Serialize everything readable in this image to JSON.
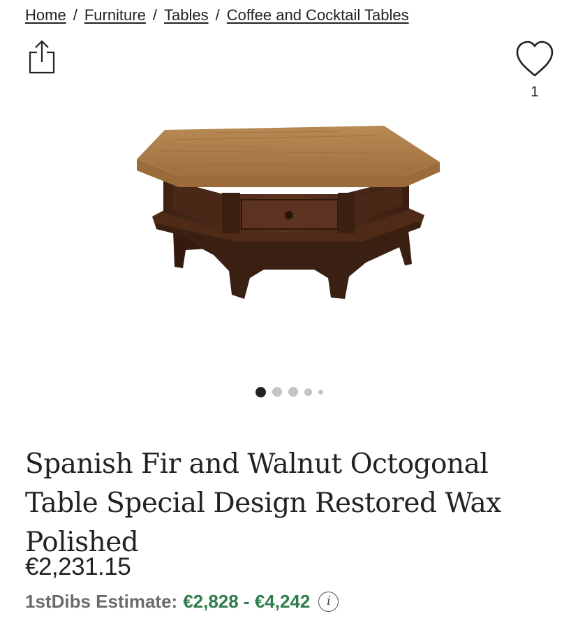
{
  "breadcrumb": {
    "items": [
      "Home",
      "Furniture",
      "Tables",
      "Coffee and Cocktail Tables"
    ],
    "separator": "/"
  },
  "actions": {
    "share_icon": "share-icon",
    "favorite_icon": "heart-icon",
    "favorite_count": "1"
  },
  "gallery": {
    "image_alt": "Spanish Fir and Walnut Octogonal Table",
    "slide_count": 5,
    "active_index": 0
  },
  "product": {
    "title": "Spanish Fir and Walnut Octogonal Table Special Design Restored Wax Polished",
    "price": "€2,231.15",
    "estimate_label": "1stDibs Estimate:",
    "estimate_value": "€2,828 - €4,242",
    "info_icon": "info-icon",
    "info_glyph": "i"
  },
  "colors": {
    "text": "#222222",
    "muted": "#6b6b6b",
    "estimate_green": "#2e7d4a",
    "dot_active": "#222222",
    "dot_inactive": "#c4c4c4"
  }
}
